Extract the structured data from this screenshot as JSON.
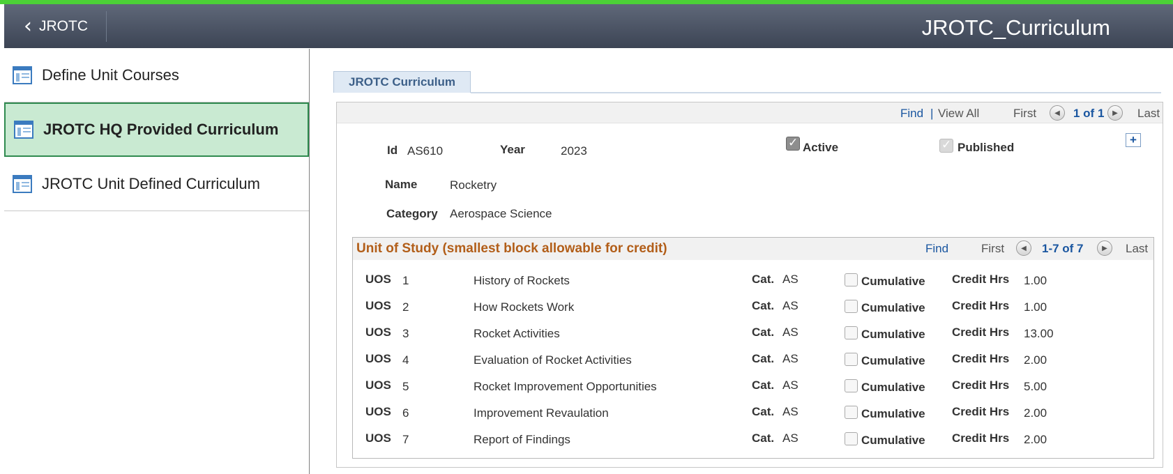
{
  "header": {
    "back_label": "JROTC",
    "title": "JROTC_Curriculum"
  },
  "sidebar": {
    "items": [
      {
        "label": "Define Unit Courses"
      },
      {
        "label": "JROTC HQ Provided Curriculum"
      },
      {
        "label": "JROTC Unit Defined Curriculum"
      }
    ]
  },
  "tab": {
    "label": "JROTC Curriculum"
  },
  "nav": {
    "find": "Find",
    "separator": "|",
    "view_all": "View All",
    "first": "First",
    "count": "1 of 1",
    "last": "Last"
  },
  "record": {
    "id_label": "Id",
    "id_value": "AS610",
    "year_label": "Year",
    "year_value": "2023",
    "active_label": "Active",
    "active_checked": true,
    "published_label": "Published",
    "published_checked": true,
    "name_label": "Name",
    "name_value": "Rocketry",
    "category_label": "Category",
    "category_value": "Aerospace Science",
    "add_label": "+"
  },
  "uos_section": {
    "title": "Unit of Study (smallest block allowable for credit)",
    "find": "Find",
    "first": "First",
    "count": "1-7 of 7",
    "last": "Last",
    "uos_label": "UOS",
    "cat_label": "Cat.",
    "cumulative_label": "Cumulative",
    "credit_label": "Credit Hrs",
    "rows": [
      {
        "num": "1",
        "title": "History of Rockets",
        "cat": "AS",
        "credit": "1.00"
      },
      {
        "num": "2",
        "title": "How Rockets Work",
        "cat": "AS",
        "credit": "1.00"
      },
      {
        "num": "3",
        "title": "Rocket Activities",
        "cat": "AS",
        "credit": "13.00"
      },
      {
        "num": "4",
        "title": "Evaluation of Rocket Activities",
        "cat": "AS",
        "credit": "2.00"
      },
      {
        "num": "5",
        "title": "Rocket Improvement Opportunities",
        "cat": "AS",
        "credit": "5.00"
      },
      {
        "num": "6",
        "title": "Improvement Revaulation",
        "cat": "AS",
        "credit": "2.00"
      },
      {
        "num": "7",
        "title": "Report of Findings",
        "cat": "AS",
        "credit": "2.00"
      }
    ]
  }
}
